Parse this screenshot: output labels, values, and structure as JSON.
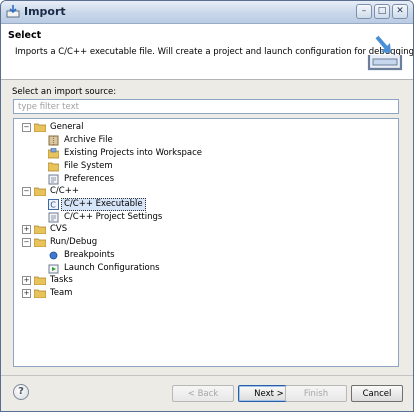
{
  "window": {
    "title": "Import"
  },
  "titlebar": {
    "minimize": "–",
    "maximize": "□",
    "close": "✕"
  },
  "header": {
    "title": "Select",
    "description": "Imports a C/C++ executable file. Will create a project and launch configuration for debugging."
  },
  "source_label": "Select an import source:",
  "filter": {
    "placeholder": "type filter text",
    "value": ""
  },
  "tree": {
    "groups": [
      {
        "label": "General",
        "expanded": true,
        "toggle": "−",
        "children": [
          "Archive File",
          "Existing Projects into Workspace",
          "File System",
          "Preferences"
        ]
      },
      {
        "label": "C/C++",
        "expanded": true,
        "toggle": "−",
        "children": [
          "C/C++ Executable",
          "C/C++ Project Settings"
        ],
        "selected_child": "C/C++ Executable"
      },
      {
        "label": "CVS",
        "expanded": false,
        "toggle": "+",
        "children": []
      },
      {
        "label": "Run/Debug",
        "expanded": true,
        "toggle": "−",
        "children": [
          "Breakpoints",
          "Launch Configurations"
        ]
      },
      {
        "label": "Tasks",
        "expanded": false,
        "toggle": "+",
        "children": []
      },
      {
        "label": "Team",
        "expanded": false,
        "toggle": "+",
        "children": []
      }
    ]
  },
  "buttons": {
    "help": "?",
    "back": "< Back",
    "next": "Next >",
    "finish": "Finish",
    "cancel": "Cancel"
  },
  "colors": {
    "selection": "#d6e5f7",
    "folder": "#e8c25a",
    "title_bar": "#c9d7ea"
  }
}
